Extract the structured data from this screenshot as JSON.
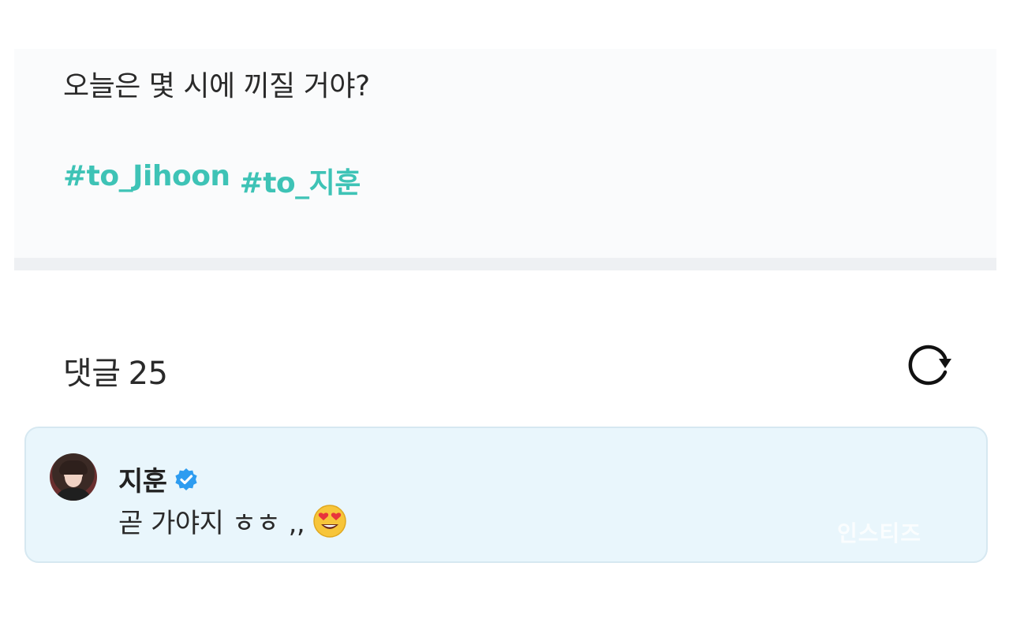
{
  "post": {
    "text": "오늘은 몇 시에 끼질 거야?",
    "hashtags": [
      "#to_Jihoon",
      "#to_지훈"
    ]
  },
  "comments": {
    "label": "댓글",
    "count": "25",
    "refresh_icon": "refresh-icon"
  },
  "comment": {
    "username": "지훈",
    "verified_icon": "verified-badge-icon",
    "text": "곧 가야지 ㅎㅎ ,,",
    "emoji_icon": "heart-eyes-emoji"
  },
  "watermark": "인스티즈",
  "colors": {
    "hashtag": "#3ec3b6",
    "verified": "#2d9cf0",
    "comment_bg": "#e9f6fc"
  }
}
